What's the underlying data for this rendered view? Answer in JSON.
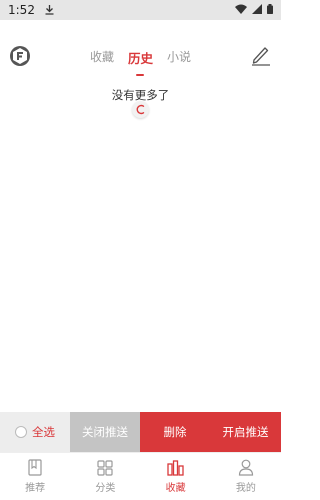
{
  "status_bar": {
    "time": "1:52"
  },
  "header": {
    "tabs": [
      {
        "label": "收藏",
        "active": false
      },
      {
        "label": "历史",
        "active": true
      },
      {
        "label": "小说",
        "active": false
      }
    ]
  },
  "content": {
    "empty_text": "没有更多了"
  },
  "action_bar": {
    "select_all": "全选",
    "close_push": "关闭推送",
    "delete": "删除",
    "open_push": "开启推送"
  },
  "bottom_nav": [
    {
      "label": "推荐",
      "icon": "book-icon",
      "active": false
    },
    {
      "label": "分类",
      "icon": "grid-icon",
      "active": false
    },
    {
      "label": "收藏",
      "icon": "bookshelf-icon",
      "active": true
    },
    {
      "label": "我的",
      "icon": "profile-icon",
      "active": false
    }
  ],
  "colors": {
    "accent": "#d9383a",
    "disabled": "#c4c4c4"
  }
}
